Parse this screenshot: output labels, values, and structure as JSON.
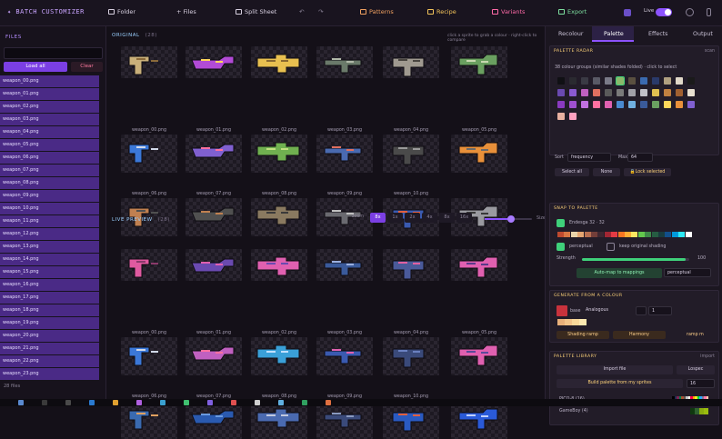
{
  "app": {
    "title": "✦ BATCH CUSTOMIZER"
  },
  "toolbar": {
    "folder": "Folder",
    "files": "+ Files",
    "split_sheet": "Split Sheet",
    "undo": "↶",
    "redo": "↷",
    "patterns": "Patterns",
    "recipe": "Recipe",
    "variants": "Variants",
    "export": "Export",
    "live_label": "Live"
  },
  "sidebar": {
    "title": "FILES",
    "load_all": "Load all",
    "clear": "Clear",
    "files": [
      "weapon_00.png",
      "weapon_01.png",
      "weapon_02.png",
      "weapon_03.png",
      "weapon_04.png",
      "weapon_05.png",
      "weapon_06.png",
      "weapon_07.png",
      "weapon_08.png",
      "weapon_09.png",
      "weapon_10.png",
      "weapon_11.png",
      "weapon_12.png",
      "weapon_13.png",
      "weapon_14.png",
      "weapon_15.png",
      "weapon_16.png",
      "weapon_17.png",
      "weapon_18.png",
      "weapon_19.png",
      "weapon_20.png",
      "weapon_21.png",
      "weapon_22.png",
      "weapon_23.png"
    ],
    "count": "28 files"
  },
  "original": {
    "title": "ORIGINAL",
    "count": "(28)",
    "hint": "click a sprite to grab a colour · right-click to compare",
    "labels": [
      "weapon_00.png",
      "weapon_01.png",
      "weapon_02.png",
      "weapon_03.png",
      "weapon_04.png",
      "weapon_05.png",
      "weapon_06.png",
      "weapon_07.png",
      "weapon_08.png",
      "weapon_09.png",
      "weapon_10.png"
    ]
  },
  "preview": {
    "title": "LIVE PREVIEW",
    "count": "(28)",
    "zoom_label": "zoom",
    "zoom_options": [
      "8x",
      "1x",
      "2x",
      "4x",
      "8x",
      "16x"
    ],
    "size_label": "Size",
    "labels": [
      "weapon_00.png",
      "weapon_01.png",
      "weapon_02.png",
      "weapon_03.png",
      "weapon_04.png",
      "weapon_05.png",
      "weapon_06.png",
      "weapon_07.png",
      "weapon_08.png",
      "weapon_09.png",
      "weapon_10.png"
    ]
  },
  "tabs": [
    "Recolour",
    "Palette",
    "Effects",
    "Output"
  ],
  "palette_radar": {
    "title": "PALETTE RADAR",
    "scan": "scan",
    "desc": "38 colour groups (similar shades folded) · click to select",
    "sort_label": "Sort",
    "sort_value": "frequency",
    "max_label": "Max",
    "max_value": "64",
    "select_all": "Select all",
    "none": "None",
    "lock": "🔒Lock selected"
  },
  "snap": {
    "title": "SNAP TO PALETTE",
    "palette_name": "Endesga 32 · 32",
    "perceptual": "perceptual",
    "keep_shading": "keep original shading",
    "strength_label": "Strength",
    "strength_value": "100",
    "strength_fraction": 0.97,
    "automap": "Auto-map to mappings",
    "method": "perceptual"
  },
  "generate": {
    "title": "GENERATE FROM A COLOUR",
    "base_label": "base",
    "harmony": "Analogous",
    "count": "1",
    "shading_ramp": "Shading ramp",
    "harmony_btn": "Harmony",
    "ramp_hint": "ramp m"
  },
  "library": {
    "title": "PALETTE LIBRARY",
    "import_hint": "import",
    "import_file": "Import file",
    "lospec": "Lospec",
    "build": "Build palette from my sprites",
    "build_count": "16",
    "items": [
      "PICO-8 (16)",
      "GameBoy (4)"
    ]
  }
}
